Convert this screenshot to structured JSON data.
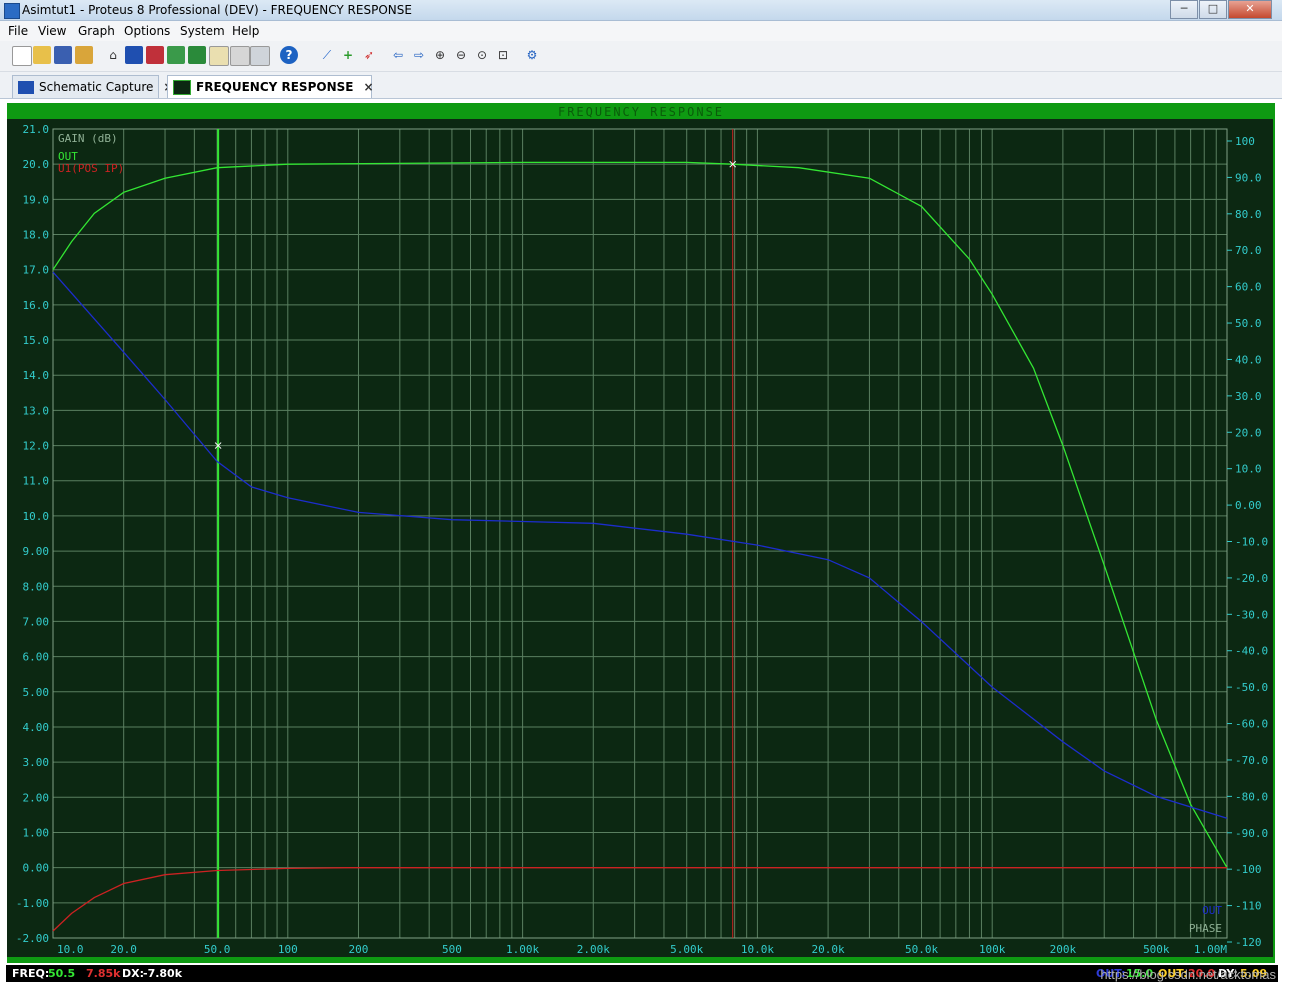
{
  "window": {
    "title": "Asimtut1 - Proteus 8 Professional (DEV) - FREQUENCY RESPONSE",
    "min": "─",
    "max": "□",
    "close": "✕"
  },
  "menu": [
    "File",
    "View",
    "Graph",
    "Options",
    "System",
    "Help"
  ],
  "toolbar_icons": [
    "new-file-icon",
    "open-folder-icon",
    "save-icon",
    "import-icon",
    "home-icon",
    "schematic-capture-icon",
    "pcb-layout-icon",
    "3d-visualizer-icon",
    "gerber-icon",
    "bill-of-materials-icon",
    "design-explorer-icon",
    "help-icon",
    "graph-simulate-icon",
    "add-trace-icon",
    "run-simulation-icon",
    "arrow-left-icon",
    "arrow-right-icon",
    "zoom-in-icon",
    "zoom-out-icon",
    "zoom-all-icon",
    "zoom-area-icon",
    "graph-config-icon"
  ],
  "tabs": [
    {
      "label": "Schematic Capture",
      "icon": "schematic-icon",
      "close": "×",
      "active": false
    },
    {
      "label": "FREQUENCY RESPONSE",
      "icon": "graph-icon",
      "close": "×",
      "active": true
    }
  ],
  "graph": {
    "title": "FREQUENCY RESPONSE",
    "left_axis_label": "GAIN (dB)",
    "right_axis_label": "PHASE",
    "colors": {
      "bg": "#0c2812",
      "grid": "#5a7f60",
      "axis_text": "#33cccc",
      "frame": "#0e9a12"
    }
  },
  "chart_data": {
    "type": "line",
    "title": "FREQUENCY RESPONSE",
    "xscale": "log",
    "xlim": [
      10,
      1000000
    ],
    "x_ticks": [
      10,
      20,
      50,
      100,
      200,
      500,
      1000,
      2000,
      5000,
      10000,
      20000,
      50000,
      100000,
      200000,
      500000,
      1000000
    ],
    "x_tick_labels": [
      "10.0",
      "20.0",
      "50.0",
      "100",
      "200",
      "500",
      "1.00k",
      "2.00k",
      "5.00k",
      "10.0k",
      "20.0k",
      "50.0k",
      "100k",
      "200k",
      "500k",
      "1.00M"
    ],
    "y_left_label": "GAIN (dB)",
    "y_left_lim": [
      -2,
      21
    ],
    "y_left_ticks": [
      21,
      20,
      19,
      18,
      17,
      16,
      15,
      14,
      13,
      12,
      11,
      10,
      9,
      8,
      7,
      6,
      5,
      4,
      3,
      2,
      1,
      0,
      -1,
      -2
    ],
    "y_left_tick_labels": [
      "21.0",
      "20.0",
      "19.0",
      "18.0",
      "17.0",
      "16.0",
      "15.0",
      "14.0",
      "13.0",
      "12.0",
      "11.0",
      "10.0",
      "9.00",
      "8.00",
      "7.00",
      "6.00",
      "5.00",
      "4.00",
      "3.00",
      "2.00",
      "1.00",
      "0.00",
      "-1.00",
      "-2.00"
    ],
    "y_right_label": "PHASE",
    "y_right_lim": [
      -120,
      100
    ],
    "y_right_ticks": [
      100,
      90,
      80,
      70,
      60,
      50,
      40,
      30,
      20,
      10,
      0,
      -10,
      -20,
      -30,
      -40,
      -50,
      -60,
      -70,
      -80,
      -90,
      -100,
      -110,
      -120
    ],
    "y_right_tick_labels": [
      "100",
      "90.0",
      "80.0",
      "70.0",
      "60.0",
      "50.0",
      "40.0",
      "30.0",
      "20.0",
      "10.0",
      "0.00",
      "-10.0",
      "-20.0",
      "-30.0",
      "-40.0",
      "-50.0",
      "-60.0",
      "-70.0",
      "-80.0",
      "-90.0",
      "-100",
      "-110",
      "-120"
    ],
    "series": [
      {
        "name": "OUT",
        "axis": "left",
        "color": "#33e633",
        "legend_color": "#33e633",
        "points": [
          [
            10,
            17.0
          ],
          [
            12,
            17.8
          ],
          [
            15,
            18.6
          ],
          [
            20,
            19.2
          ],
          [
            30,
            19.6
          ],
          [
            50,
            19.9
          ],
          [
            100,
            20.0
          ],
          [
            1000,
            20.05
          ],
          [
            5000,
            20.05
          ],
          [
            7850,
            20.0
          ],
          [
            15000,
            19.9
          ],
          [
            30000,
            19.6
          ],
          [
            50000,
            18.8
          ],
          [
            80000,
            17.3
          ],
          [
            100000,
            16.3
          ],
          [
            150000,
            14.2
          ],
          [
            200000,
            12.0
          ],
          [
            300000,
            8.6
          ],
          [
            500000,
            4.2
          ],
          [
            700000,
            1.8
          ],
          [
            1000000,
            0.0
          ]
        ]
      },
      {
        "name": "U1(POS IP)",
        "axis": "left",
        "color": "#cc2222",
        "legend_color": "#cc2222",
        "points": [
          [
            10,
            -1.8
          ],
          [
            12,
            -1.3
          ],
          [
            15,
            -0.85
          ],
          [
            20,
            -0.45
          ],
          [
            30,
            -0.2
          ],
          [
            50,
            -0.08
          ],
          [
            100,
            -0.02
          ],
          [
            180,
            0.0
          ],
          [
            1000000,
            0.0
          ]
        ]
      },
      {
        "name": "OUT",
        "axis": "right",
        "color": "#1c2dcc",
        "legend_color": "#1c2dcc",
        "points": [
          [
            10,
            64
          ],
          [
            20,
            42
          ],
          [
            30,
            29
          ],
          [
            50,
            12
          ],
          [
            70,
            5
          ],
          [
            100,
            2
          ],
          [
            200,
            -2
          ],
          [
            500,
            -4
          ],
          [
            1000,
            -4.5
          ],
          [
            2000,
            -5
          ],
          [
            5000,
            -8
          ],
          [
            10000,
            -11
          ],
          [
            20000,
            -15
          ],
          [
            30000,
            -20
          ],
          [
            50000,
            -32
          ],
          [
            100000,
            -50
          ],
          [
            200000,
            -65
          ],
          [
            300000,
            -73
          ],
          [
            500000,
            -80
          ],
          [
            1000000,
            -86
          ]
        ]
      }
    ],
    "cursors": [
      {
        "x": 50.5,
        "color": "#33e633",
        "width": 2
      },
      {
        "x": 7850,
        "color": "#cc2222",
        "width": 1
      }
    ],
    "markers": [
      {
        "x": 50.5,
        "y": 12.0,
        "axis": "left"
      },
      {
        "x": 7850,
        "y": 20.0,
        "axis": "left"
      }
    ]
  },
  "status": {
    "freq_label": "FREQ:",
    "freq_value": "50.5",
    "cursor2_value": "7.85k",
    "dx_label": "DX:",
    "dx_value": "-7.80k",
    "right_label1": "OUT:",
    "right_value1": "15.0",
    "right_label2": "OUT:",
    "right_value2": "20.0",
    "right_dy_label": "DY:",
    "right_dy_value": "5.09"
  },
  "watermark": "https://blog.csdn.net/acktomas"
}
